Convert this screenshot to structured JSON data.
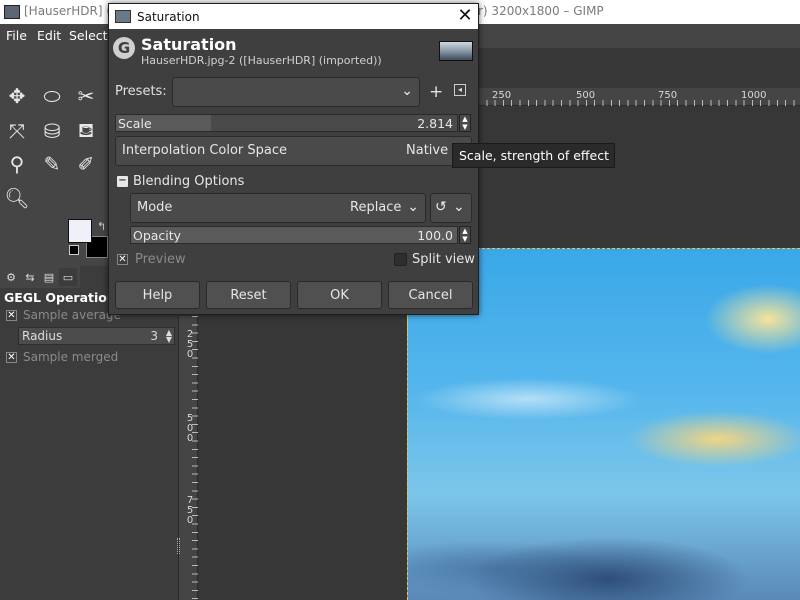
{
  "main_window": {
    "title_left": "[HauserHDR] (in",
    "title_right": "r) 3200x1800 – GIMP"
  },
  "menubar": {
    "items": [
      "File",
      "Edit",
      "Select"
    ]
  },
  "toolbox": {
    "fg_color": "#f0f0fa",
    "bg_color": "#000000"
  },
  "tool_options": {
    "title": "GEGL Operation",
    "sample_average_label": "Sample average",
    "radius_label": "Radius",
    "radius_value": "3",
    "sample_merged_label": "Sample merged"
  },
  "rulers": {
    "h_ticks": [
      "250",
      "500",
      "750",
      "1000"
    ],
    "v_ticks": [
      "250",
      "500",
      "750"
    ]
  },
  "dialog": {
    "window_title": "Saturation",
    "header_title": "Saturation",
    "header_subtitle": "HauserHDR.jpg-2 ([HauserHDR] (imported))",
    "presets_label": "Presets:",
    "presets_value": "",
    "scale_label": "Scale",
    "scale_value": "2.814",
    "interp_label": "Interpolation Color Space",
    "interp_value": "Native",
    "blending_label": "Blending Options",
    "mode_label": "Mode",
    "mode_value": "Replace",
    "opacity_label": "Opacity",
    "opacity_value": "100.0",
    "preview_label": "Preview",
    "split_view_label": "Split view",
    "buttons": {
      "help": "Help",
      "reset": "Reset",
      "ok": "OK",
      "cancel": "Cancel"
    },
    "scale_fill_fraction": 0.28,
    "opacity_fill_fraction": 1.0
  },
  "tooltip": {
    "text": "Scale, strength of effect"
  }
}
